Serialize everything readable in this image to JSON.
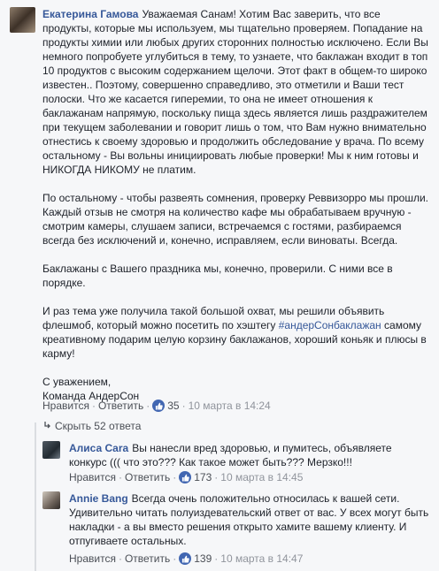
{
  "main_comment": {
    "author": "Екатерина Гамова",
    "paragraphs": [
      "Уважаемая Санам! Хотим Вас заверить, что все продукты, которые мы используем, мы тщательно проверяем. Попадание на продукты химии или любых других сторонних полностью исключено. Если Вы немного попробуете углубиться в тему, то узнаете, что баклажан входит в топ 10 продуктов с высоким содержанием щелочи. Этот факт в общем-то широко известен.. Поэтому, совершенно справедливо, это отметили и Ваши тест полоски. Что же касается гиперемии, то она не имеет отношения к баклажанам напрямую, поскольку пища здесь является лишь раздражителем при текущем заболевании и говорит лишь о том, что Вам нужно внимательно отнестись к своему здоровью и продолжить обследование у врача. По всему остальному - Вы вольны инициировать любые проверки! Мы к ним готовы и НИКОГДА НИКОМУ не платим.",
      "По остальному - чтобы развеять сомнения, проверку Реввизорро мы прошли. Каждый отзыв не смотря на количество кафе мы обрабатываем вручную - смотрим камеры, слушаем записи, встречаемся с гостями, разбираемся всегда без исключений и, конечно, исправляем, если виноваты. Всегда.",
      "Баклажаны с Вашего праздника мы, конечно, проверили. С ними все в порядке."
    ],
    "p4_before": "И раз тема уже получила такой большой охват, мы решили объявить флешмоб, который можно посетить по хэштегу ",
    "p4_hashtag": "#андерСонбаклажан",
    "p4_after": " самому креативному подарим целую корзину баклажанов, хороший коньяк и плюсы в карму!",
    "signature_line1": "С уважением,",
    "signature_line2": "Команда АндерСон",
    "like_label": "Нравится",
    "reply_label": "Ответить",
    "likes": "35",
    "date": "10 марта в 14:24"
  },
  "hide_replies_label": "Скрыть 52 ответа",
  "replies": [
    {
      "author": "Алиса Cara",
      "text": "Вы нанесли вред здоровью, и пумитесь, объявляете конкурс ((( что это??? Как такое может быть??? Мерзко!!!",
      "like_label": "Нравится",
      "reply_label": "Ответить",
      "likes": "173",
      "date": "10 марта в 14:45"
    },
    {
      "author": "Annie Bang",
      "text": "Всегда очень положительно относилась к вашей сети. Удивительно читать полуиздевательский ответ от вас. У всех могут быть накладки - а вы вместо решения открыто хамите вашему клиенту. И отпугиваете остальных.",
      "like_label": "Нравится",
      "reply_label": "Ответить",
      "likes": "139",
      "date": "10 марта в 14:47"
    }
  ],
  "colors": {
    "link": "#365899",
    "text": "#1d2129",
    "meta": "#90949c",
    "like_badge": "#4267b2",
    "background": "#f6f7f9"
  },
  "icons": [
    "like-thumb-icon",
    "hide-arrow-icon"
  ]
}
